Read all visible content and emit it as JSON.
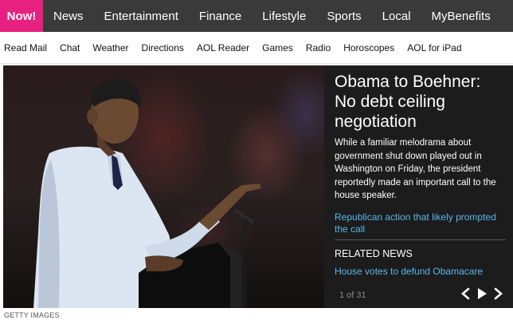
{
  "topnav": {
    "active_label": "Now!",
    "items": [
      "News",
      "Entertainment",
      "Finance",
      "Lifestyle",
      "Sports",
      "Local",
      "MyBenefits"
    ]
  },
  "subnav": {
    "items": [
      "Read Mail",
      "Chat",
      "Weather",
      "Directions",
      "AOL Reader",
      "Games",
      "Radio",
      "Horoscopes",
      "AOL for iPad"
    ]
  },
  "hero": {
    "headline": "Obama to Boehner: No debt ceiling negotiation",
    "summary": "While a familiar melodrama about government shut down played out in Washington on Friday, the president reportedly made an important call to the house speaker.",
    "more_link": "Republican action that likely prompted the call",
    "related_title": "RELATED NEWS",
    "related_link": "House votes to defund Obamacare",
    "counter": "1 of 31",
    "controls": {
      "prev_icon": "chevron-left-icon",
      "play_icon": "play-icon",
      "next_icon": "chevron-right-icon"
    },
    "photo_credit": "GETTY IMAGES"
  },
  "colors": {
    "accent": "#e8207f",
    "link": "#57b7ea",
    "nav_bg": "#3a3a3a",
    "panel_bg": "#1c1c1c"
  }
}
